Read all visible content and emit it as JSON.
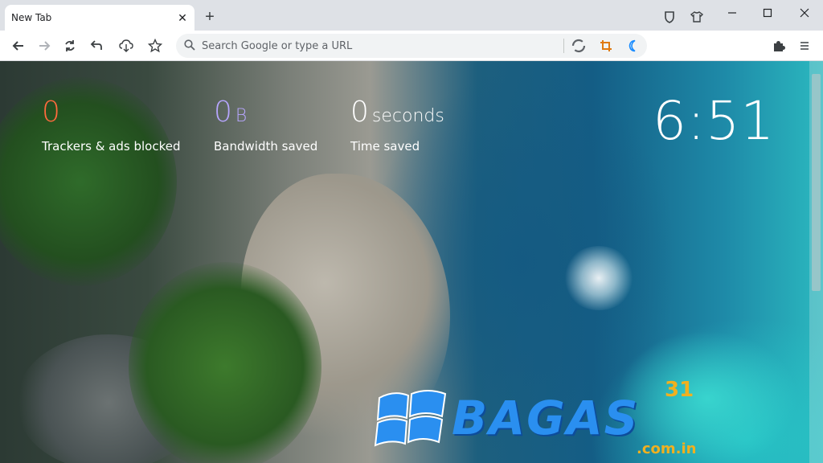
{
  "browser": {
    "tab": {
      "title": "New Tab"
    },
    "omnibox": {
      "placeholder": "Search Google or type a URL"
    }
  },
  "stats": [
    {
      "value": "0",
      "unit": "",
      "label": "Trackers & ads blocked",
      "color": "#ff6a3d"
    },
    {
      "value": "0",
      "unit": "B",
      "label": "Bandwidth saved",
      "color": "#b7a6ff"
    },
    {
      "value": "0",
      "unit": "seconds",
      "label": "Time saved",
      "color": "#ffffff"
    }
  ],
  "clock": {
    "time": "6:51"
  },
  "watermark": {
    "text": "BAGAS",
    "number": "31",
    "domain": ".com.in"
  },
  "icons": [
    "shield-icon",
    "shirt-icon",
    "minimize-icon",
    "maximize-icon",
    "close-icon",
    "back-icon",
    "forward-icon",
    "reload-icon",
    "undo-icon",
    "download-icon",
    "star-icon",
    "search-icon",
    "sync-icon",
    "crop-icon",
    "moon-icon",
    "puzzle-icon",
    "menu-icon"
  ]
}
